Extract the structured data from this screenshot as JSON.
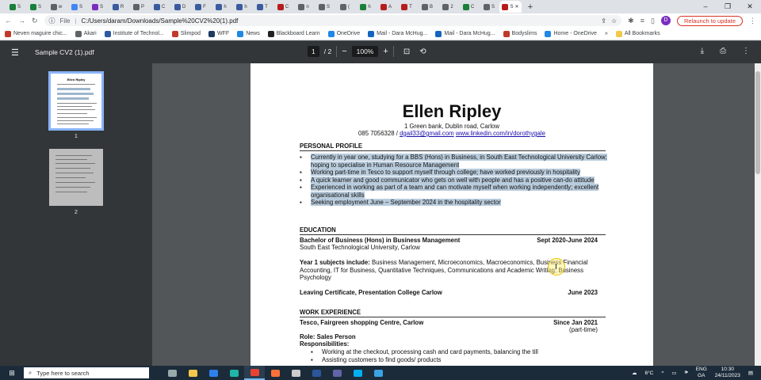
{
  "browser": {
    "tabs": [
      {
        "letter": "S",
        "color": "#188038"
      },
      {
        "letter": "S",
        "color": "#188038"
      },
      {
        "letter": "w",
        "color": "#5f6368"
      },
      {
        "letter": "S",
        "color": "#4285f4"
      },
      {
        "letter": "S",
        "color": "#7b2cbf"
      },
      {
        "letter": "R",
        "color": "#3a5ba0"
      },
      {
        "letter": "P",
        "color": "#5f6368"
      },
      {
        "letter": "C",
        "color": "#3a5ba0"
      },
      {
        "letter": "D",
        "color": "#3a5ba0"
      },
      {
        "letter": "F",
        "color": "#3a5ba0"
      },
      {
        "letter": "h",
        "color": "#3a5ba0"
      },
      {
        "letter": "h",
        "color": "#3a5ba0"
      },
      {
        "letter": "T",
        "color": "#3a5ba0"
      },
      {
        "letter": "C",
        "color": "#b71c1c"
      },
      {
        "letter": "n",
        "color": "#5f6368"
      },
      {
        "letter": "S",
        "color": "#5f6368"
      },
      {
        "letter": "(",
        "color": "#5f6368"
      },
      {
        "letter": "h",
        "color": "#188038"
      },
      {
        "letter": "A",
        "color": "#b71c1c"
      },
      {
        "letter": "T",
        "color": "#b71c1c"
      },
      {
        "letter": "B",
        "color": "#5f6368"
      },
      {
        "letter": "2",
        "color": "#5f6368"
      },
      {
        "letter": "C",
        "color": "#188038"
      },
      {
        "letter": "S",
        "color": "#5f6368"
      },
      {
        "letter": "S",
        "color": "#b71c1c",
        "active": true
      }
    ],
    "new_tab": "+",
    "window_controls": {
      "minimize": "–",
      "restore": "❐",
      "close": "✕"
    },
    "address": {
      "scheme": "File",
      "url": "C:/Users/daram/Downloads/Sample%20CV2%20(1).pdf"
    },
    "relaunch": "Relaunch to update",
    "profile_initial": "D",
    "bookmarks": [
      {
        "label": "Neven maguire chic...",
        "color": "#c0392b"
      },
      {
        "label": "Akari",
        "color": "#5f6368"
      },
      {
        "label": "Institute of Technol...",
        "color": "#2c5aa0"
      },
      {
        "label": "Slimpod",
        "color": "#c0392b"
      },
      {
        "label": "WFF",
        "color": "#1e3a5f"
      },
      {
        "label": "News",
        "color": "#1e88e5"
      },
      {
        "label": "Blackboard Learn",
        "color": "#222"
      },
      {
        "label": "OneDrive",
        "color": "#1e88e5"
      },
      {
        "label": "Mail - Dara McHug...",
        "color": "#1565c0"
      },
      {
        "label": "Mail - Dara McHug...",
        "color": "#1565c0"
      },
      {
        "label": "Bodyslims",
        "color": "#c0392b"
      },
      {
        "label": "Home - OneDrive",
        "color": "#1e88e5"
      }
    ],
    "more_bookmarks": "»",
    "all_bookmarks": "All Bookmarks"
  },
  "pdf": {
    "file_name": "Sample CV2 (1).pdf",
    "page_current": "1",
    "page_total": "/ 2",
    "zoom": "100%",
    "thumbnails": [
      "1",
      "2"
    ]
  },
  "cv": {
    "name": "Ellen Ripley",
    "address": "1 Green bank, Dublin road, Carlow",
    "phone": "085 7056328",
    "slash": "/",
    "email": "dgail33@gmail.com",
    "linkedin": "www.linkedin.com/in/dorothygale",
    "profile_heading": "PERSONAL PROFILE",
    "profile_items": [
      "Currently in year one, studying for a BBS (Hons) in Business, in South East Technological University Carlow; hoping to specialise in Human Resource Management",
      "Working part-time in Tesco to support myself through college; have worked previously in hospitality",
      "A quick learner and good communicator who gets on well with people and has a positive can-do attitude",
      "Experienced in working as part of a team and can motivate myself when working independently; excellent organisational skills",
      "Seeking employment June – September 2024 in the hospitality sector"
    ],
    "education_heading": "EDUCATION",
    "degree": "Bachelor of Business (Hons) in Business Management",
    "degree_dates": "Sept 2020-June 2024",
    "university": "South East Technological University, Carlow",
    "subjects_label": "Year 1 subjects include:",
    "subjects": "Business Management, Microeconomics, Macroeconomics, Business Financial Accounting, IT for Business, Quantitative Techniques, Communications and Academic Writing, Business Psychology",
    "leaving_cert": "Leaving Certificate, Presentation College Carlow",
    "leaving_date": "June 2023",
    "work_heading": "WORK EXPERIENCE",
    "employer": "Tesco, Fairgreen shopping Centre, Carlow",
    "employer_since": "Since Jan 2021",
    "employer_type": "(part-time)",
    "role": "Role: Sales Person",
    "resp_label": "Responsibilities:",
    "resp_items": [
      "Working at the checkout, processing cash and card payments, balancing the till",
      "Assisting customers to find goods/ products"
    ]
  },
  "taskbar": {
    "search_placeholder": "Type here to search",
    "apps": [
      {
        "name": "task-view",
        "color": "#9aa"
      },
      {
        "name": "file-explorer",
        "color": "#f2c94c"
      },
      {
        "name": "mail",
        "color": "#2f80ed"
      },
      {
        "name": "edge",
        "color": "#1fb5a8"
      },
      {
        "name": "chrome",
        "color": "#e94235",
        "active": true
      },
      {
        "name": "firefox",
        "color": "#ff7139"
      },
      {
        "name": "settings",
        "color": "#ccc"
      },
      {
        "name": "word",
        "color": "#2b579a"
      },
      {
        "name": "teams",
        "color": "#6264a7"
      },
      {
        "name": "skype",
        "color": "#00aff0"
      },
      {
        "name": "photos",
        "color": "#3aa3e3"
      }
    ],
    "weather": "6°C",
    "language_top": "ENG",
    "language_bottom": "GA",
    "time": "10:30",
    "date": "24/11/2023"
  }
}
